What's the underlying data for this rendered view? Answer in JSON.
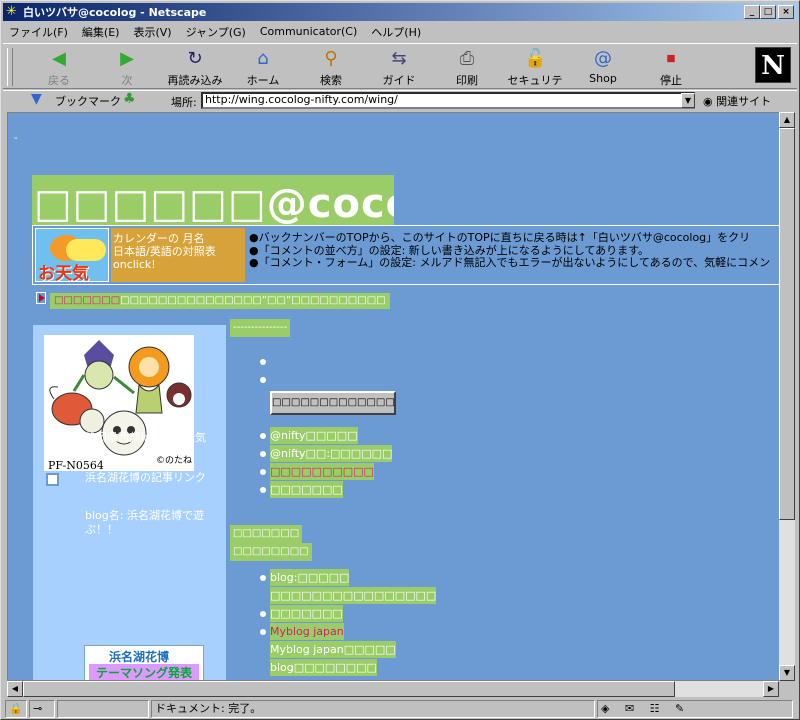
{
  "window": {
    "title": "白いツバサ@cocolog - Netscape"
  },
  "titlebar_buttons": {
    "minimize": "_",
    "maximize": "□",
    "close": "×"
  },
  "menu": [
    "ファイル(F)",
    "編集(E)",
    "表示(V)",
    "ジャンプ(G)",
    "Communicator(C)",
    "ヘルプ(H)"
  ],
  "toolbar": {
    "back": "戻る",
    "forward": "次",
    "reload": "再読み込み",
    "home": "ホーム",
    "search": "検索",
    "guide": "ガイド",
    "print": "印刷",
    "security": "セキュリティ",
    "shop": "Shop",
    "stop": "停止"
  },
  "brand_logo": "N",
  "location": {
    "bookmarks": "ブックマーク",
    "label": "場所:",
    "url": "http://wing.cocolog-nifty.com/wing/",
    "related": "関連サイト"
  },
  "page": {
    "dash": "-",
    "banner": "□□□□□□@cocolog",
    "weather_label": "お天気",
    "calendar_lines": [
      "カレンダーの 月名",
      "日本語/英語の対照表",
      "onclick!"
    ],
    "news": [
      "●バックナンバーのTOPから、このサイトのTOPに直ちに戻る時は↑「白いツバサ@cocolog」をクリ",
      "●「コメントの並べ方」の設定: 新しい書き込みが上になるようにしてあります。",
      "●「コメント・フォーム」の設定: メルアド無記入でもエラーが出ないようにしてあるので、気軽にコメン"
    ],
    "crumb_red": "□□□□□□□",
    "crumb_rest": "□□□□□□□□□□□□□□□”□□”□□□□□□□□□□",
    "sidebar": {
      "mascot_caption": "©のたね",
      "pf": "PF-N0564",
      "links": [
        "静岡県西部地域のお天気",
        "浜名湖花博の記事リンク",
        "blog名: 浜名湖花博で遊ぶ！！"
      ],
      "banner_line1": "浜名湖花博",
      "banner_line2": "テーマソング発表"
    },
    "right": {
      "h1": "---------------",
      "form_button": "□□□□□□□□□□□□□",
      "links1": [
        "@nifty□□□□□",
        "@nifty□□:□□□□□□",
        "□□□□□□□□□□",
        "□□□□□□□"
      ],
      "h2a": "□□□□□□□",
      "h2b": "□□□□□□□□",
      "links2": [
        "blog:□□□□□",
        "□□□□□□□□□□□□□□□□",
        "□□□□□□□",
        "Myblog japan",
        "Myblog japan□□□□□",
        "blog□□□□□□□□"
      ]
    }
  },
  "status": {
    "text": "ドキュメント: 完了。"
  }
}
